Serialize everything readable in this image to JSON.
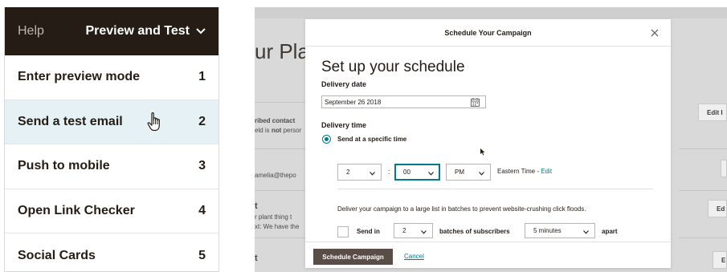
{
  "menu": {
    "help_label": "Help",
    "title": "Preview and Test",
    "items": [
      {
        "label": "Enter preview mode",
        "number": "1"
      },
      {
        "label": "Send a test email",
        "number": "2"
      },
      {
        "label": "Push to mobile",
        "number": "3"
      },
      {
        "label": "Open Link Checker",
        "number": "4"
      },
      {
        "label": "Social Cards",
        "number": "5"
      }
    ]
  },
  "background": {
    "page_title": "ur Plan",
    "row1_title": "ribed contact",
    "row1_sub_prefix": "eld is ",
    "row1_sub_bold": "not",
    "row1_sub_suffix": " persor",
    "row1_button": "Edit I",
    "row2_email": "amelia@thepo",
    "row3_title": "t",
    "row3_sub1": "r plant thing t",
    "row3_sub2": "xt: We have the",
    "row3_button": "Ed",
    "row4_title": "t",
    "row4_button": "E"
  },
  "modal": {
    "title": "Schedule Your Campaign",
    "heading": "Set up your schedule",
    "delivery_date_label": "Delivery date",
    "delivery_date_value": "September 26 2018",
    "delivery_time_label": "Delivery time",
    "radio_label": "Send at a specific time",
    "hour": "2",
    "separator": ":",
    "minute": "00",
    "meridiem": "PM",
    "timezone": "Eastern Time - ",
    "timezone_edit": "Edit",
    "batch_description": "Deliver your campaign to a large list in batches to prevent website-crushing click floods.",
    "send_in_label": "Send in",
    "batch_count": "2",
    "batches_label": "batches of subscribers",
    "interval": "5 minutes",
    "apart_label": "apart",
    "schedule_button": "Schedule Campaign",
    "cancel_link": "Cancel"
  },
  "colors": {
    "menu_header_bg": "#241c15",
    "active_item_bg": "#e5f1f4",
    "accent": "#007c89",
    "primary_button": "#5a4d48"
  },
  "icons": {
    "menu_chevron": "chevron-down-icon",
    "cursor": "hand-pointer-icon",
    "close": "close-icon",
    "calendar": "calendar-icon",
    "select_caret": "chevron-down-icon"
  }
}
